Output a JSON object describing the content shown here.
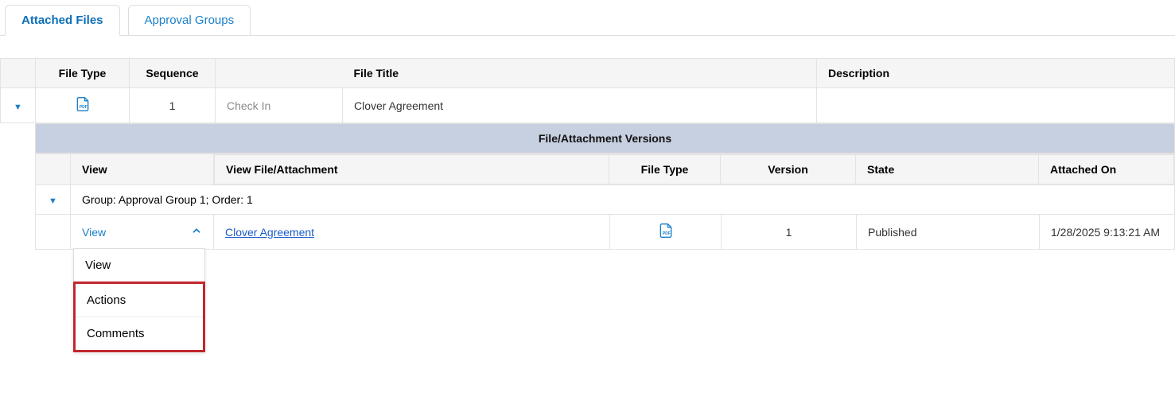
{
  "tabs": {
    "attached_files": "Attached Files",
    "approval_groups": "Approval Groups"
  },
  "outer_table": {
    "headers": {
      "file_type": "File Type",
      "sequence": "Sequence",
      "file_title": "File Title",
      "description": "Description"
    },
    "row": {
      "sequence": "1",
      "check_in": "Check In",
      "file_title": "Clover Agreement",
      "description": ""
    }
  },
  "versions": {
    "title": "File/Attachment Versions",
    "headers": {
      "view": "View",
      "view_file": "View File/Attachment",
      "file_type": "File Type",
      "version": "Version",
      "state": "State",
      "attached_on": "Attached On"
    },
    "group_label": "Group: Approval Group 1; Order: 1",
    "row": {
      "view": "View",
      "file_link": "Clover Agreement",
      "version": "1",
      "state": "Published",
      "attached_on": "1/28/2025 9:13:21 AM"
    }
  },
  "dropdown": {
    "view": "View",
    "actions": "Actions",
    "comments": "Comments"
  }
}
